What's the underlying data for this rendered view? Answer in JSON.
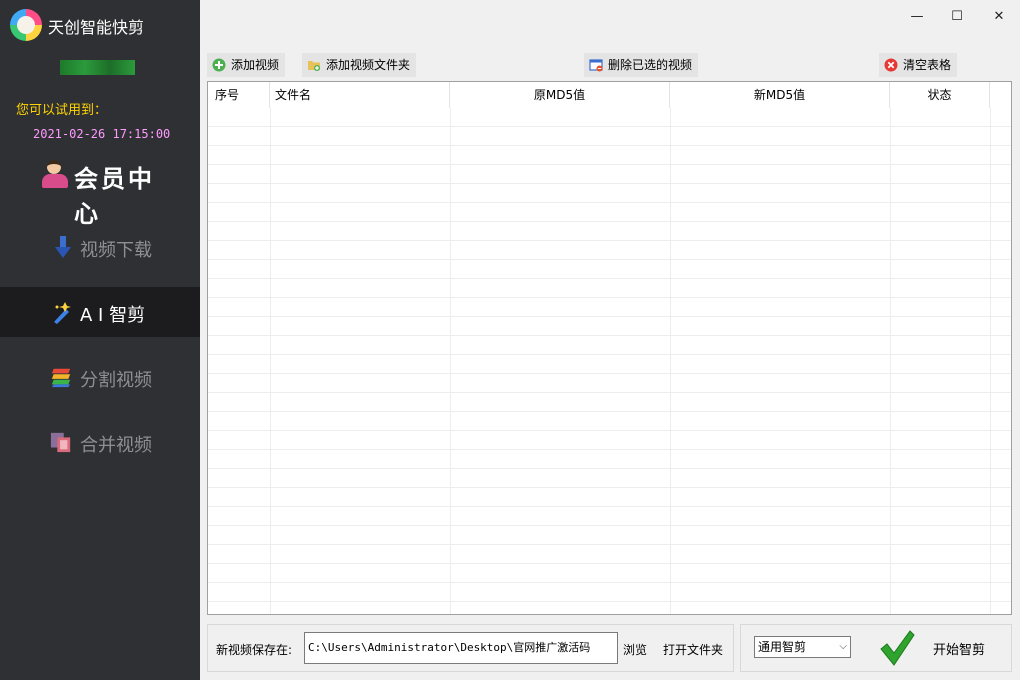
{
  "app": {
    "title": "天创智能快剪"
  },
  "sidebar": {
    "trial_label": "您可以试用到：",
    "trial_date": "2021-02-26 17:15:00",
    "member_label": "会员中心",
    "items": [
      {
        "label": "视频下载",
        "icon": "download-arrow-icon",
        "active": false
      },
      {
        "label": "A I 智剪",
        "icon": "magic-wand-icon",
        "active": true
      },
      {
        "label": "分割视频",
        "icon": "split-layers-icon",
        "active": false
      },
      {
        "label": "合并视频",
        "icon": "merge-frames-icon",
        "active": false
      }
    ]
  },
  "window": {
    "minimize": "—",
    "maximize": "☐",
    "close": "✕"
  },
  "toolbar": {
    "add_video": "添加视频",
    "add_folder": "添加视频文件夹",
    "delete_selected": "删除已选的视频",
    "clear_table": "清空表格"
  },
  "table": {
    "columns": [
      "序号",
      "文件名",
      "原MD5值",
      "新MD5值",
      "状态"
    ],
    "rows": []
  },
  "save": {
    "label": "新视频保存在:",
    "path": "C:\\Users\\Administrator\\Desktop\\官网推广激活码",
    "browse": "浏览",
    "open_folder": "打开文件夹"
  },
  "run": {
    "mode": "通用智剪",
    "start": "开始智剪"
  },
  "colors": {
    "sidebar_bg": "#2f3033",
    "sidebar_active_bg": "#1c1c1e",
    "trial_label": "#ffd400",
    "trial_date": "#ff9bff",
    "check_green": "#2ea32e"
  }
}
